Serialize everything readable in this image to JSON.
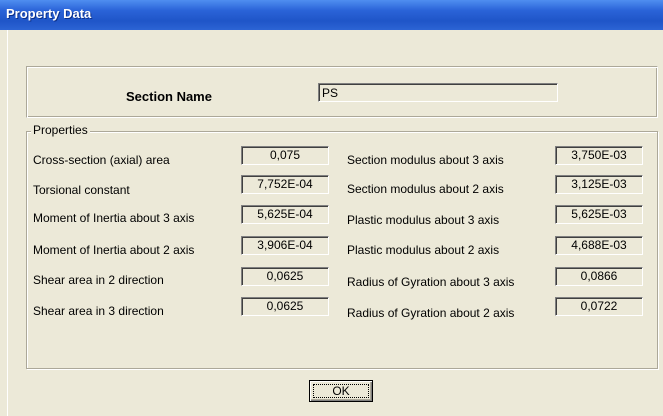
{
  "window": {
    "title": "Property Data"
  },
  "section": {
    "label": "Section Name",
    "value": "PS"
  },
  "properties": {
    "legend": "Properties",
    "left": [
      {
        "label": "Cross-section (axial) area",
        "value": "0,075"
      },
      {
        "label": "Torsional constant",
        "value": "7,752E-04"
      },
      {
        "label": "Moment of Inertia about 3 axis",
        "value": "5,625E-04"
      },
      {
        "label": "Moment of Inertia about 2 axis",
        "value": "3,906E-04"
      },
      {
        "label": "Shear area in 2 direction",
        "value": "0,0625"
      },
      {
        "label": "Shear area in 3 direction",
        "value": "0,0625"
      }
    ],
    "right": [
      {
        "label": "Section modulus about 3 axis",
        "value": "3,750E-03"
      },
      {
        "label": "Section modulus about 2 axis",
        "value": "3,125E-03"
      },
      {
        "label": "Plastic modulus about 3 axis",
        "value": "5,625E-03"
      },
      {
        "label": "Plastic modulus about 2 axis",
        "value": "4,688E-03"
      },
      {
        "label": "Radius of Gyration about 3 axis",
        "value": "0,0866"
      },
      {
        "label": "Radius of Gyration about 2 axis",
        "value": "0,0722"
      }
    ]
  },
  "buttons": {
    "ok": "OK"
  }
}
